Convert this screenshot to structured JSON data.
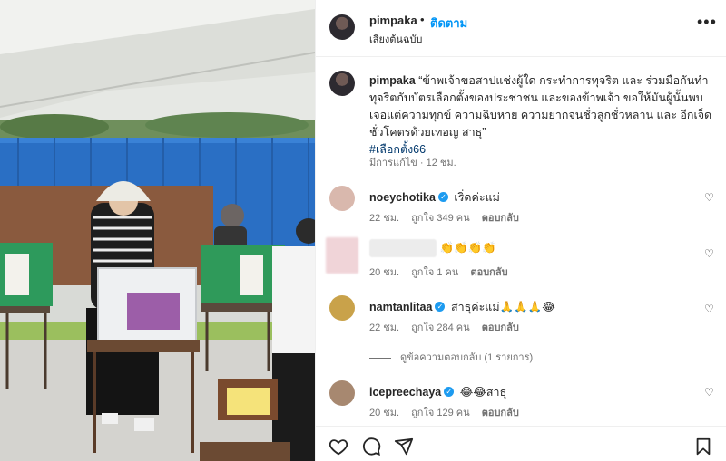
{
  "post": {
    "author": "pimpaka",
    "dot": "•",
    "follow_label": "ติดตาม",
    "subtitle": "เสียงต้นฉบับ",
    "more_label": "•••"
  },
  "caption": {
    "author": "pimpaka",
    "text": "“ข้าพเจ้าขอสาปแช่งผู้ใด กระทำการทุจริต และ ร่วมมือกันทำทุจริตกับบัตรเลือกตั้งของประชาชน และของข้าพเจ้า ขอให้มันผู้นั้นพบเจอแต่ความทุกข์ ความฉิบหาย ความยากจนชั่วลูกชั่วหลาน และ อีกเจ็ดชั่วโคตรด้วยเทอญ สาธุ”",
    "hashtag": "#เลือกตั้ง66",
    "meta": "มีการแก้ไข · 12 ชม."
  },
  "comments": [
    {
      "user": "noeychotika",
      "verified": true,
      "text": "เริ่ดค่ะแม่",
      "time": "22 ชม.",
      "likes": "ถูกใจ 349 คน",
      "reply": "ตอบกลับ",
      "avatar_color": "#d9b8ad"
    },
    {
      "user": "",
      "verified": false,
      "text": "👏👏👏👏",
      "time": "20 ชม.",
      "likes": "ถูกใจ 1 คน",
      "reply": "ตอบกลับ",
      "avatar_color": "#f0d4d8"
    },
    {
      "user": "namtanlitaa",
      "verified": true,
      "text": "สาธุค่ะแม่🙏🙏🙏😂",
      "time": "22 ชม.",
      "likes": "ถูกใจ 284 คน",
      "reply": "ตอบกลับ",
      "avatar_color": "#c9a24a"
    },
    {
      "user": "icepreechaya",
      "verified": true,
      "text": "😂😂สาธุ",
      "time": "20 ชม.",
      "likes": "ถูกใจ 129 คน",
      "reply": "ตอบกลับ",
      "avatar_color": "#a78870"
    }
  ],
  "view_replies": "ดูข้อความตอบกลับ (1 รายการ)",
  "colors": {
    "accent": "#0095f6",
    "hashtag": "#00376b",
    "muted": "#737373",
    "verified": "#1d9bf0"
  },
  "icons": [
    "heart-icon",
    "comment-icon",
    "share-icon",
    "bookmark-icon",
    "more-icon"
  ]
}
